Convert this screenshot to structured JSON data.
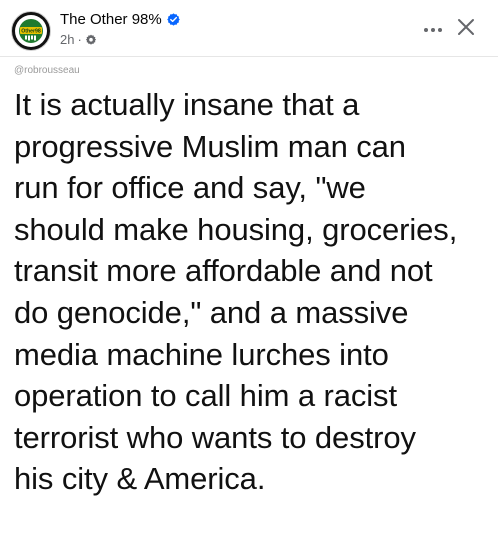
{
  "header": {
    "page_name": "The Other 98%",
    "timestamp": "2h",
    "separator": "·",
    "avatar_text": "Other 98%",
    "icons": {
      "verified": "verified-badge-icon",
      "privacy": "gear-icon",
      "more": "more-horizontal-icon",
      "close": "close-icon"
    }
  },
  "image": {
    "handle": "@robrousseau",
    "lines": [
      "It is actually insane that a",
      "progressive Muslim man can",
      "run for office and say, \"we",
      "should make housing, groceries,",
      "transit more affordable and not",
      "do genocide,\" and a massive",
      "media machine lurches into",
      "operation to call him a racist",
      "terrorist who wants to destroy",
      "his city & America."
    ]
  },
  "colors": {
    "verified_blue": "#0866ff",
    "meta_gray": "#65676b",
    "text_dark": "#111111",
    "avatar_green": "#2e9e3e"
  }
}
